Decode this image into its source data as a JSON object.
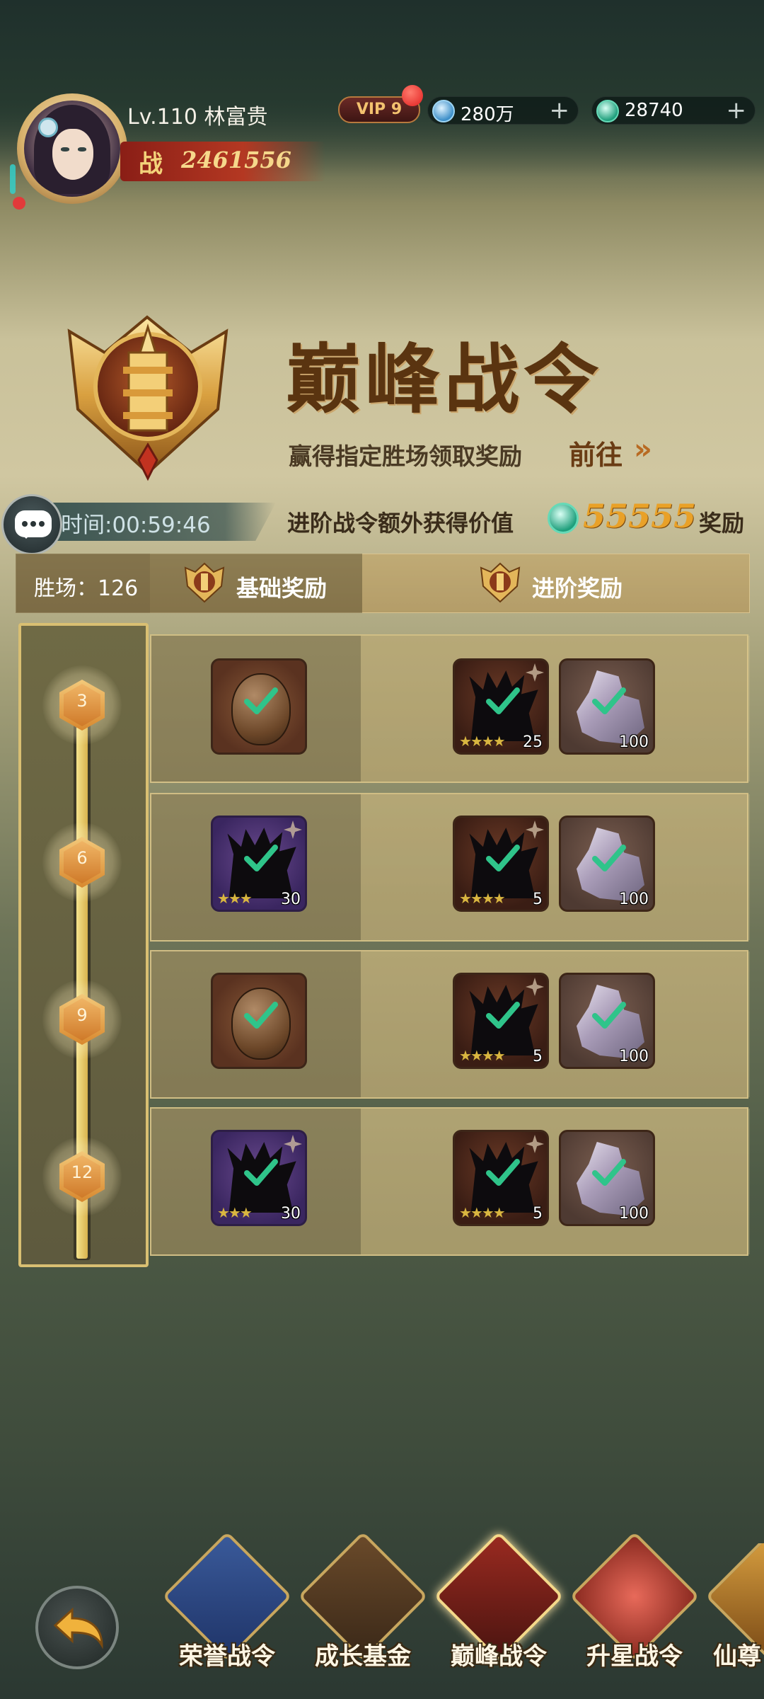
{
  "player": {
    "level_name": "Lv.110 林富贵",
    "power_glyph": "战",
    "power": "2461556",
    "vip": "VIP 9"
  },
  "resources": [
    {
      "name": "diamond",
      "value": "280万",
      "icon": "diamond-icon"
    },
    {
      "name": "jade",
      "value": "28740",
      "icon": "jade-coin-icon"
    }
  ],
  "banner": {
    "title": "巅峰战令",
    "subtitle": "赢得指定胜场领取奖励",
    "goto_label": "前往",
    "goto_arrow": "»",
    "timer": "时间:00:59:46",
    "advanced_text": "进阶战令额外获得价值",
    "advanced_value": "55555",
    "advanced_suffix": "奖励"
  },
  "columns": {
    "wins": "胜场：126",
    "base": "基础奖励",
    "advanced": "进阶奖励"
  },
  "progress": {
    "fill_fraction": 1.0
  },
  "rows": [
    {
      "milestone": "3",
      "base": [
        {
          "type": "egg",
          "count": ""
        }
      ],
      "advanced": [
        {
          "type": "hero-shard",
          "stars": "★★★★",
          "count": "25"
        },
        {
          "type": "crystal",
          "count": "100"
        }
      ]
    },
    {
      "milestone": "6",
      "base": [
        {
          "type": "hero-shard-purple",
          "stars": "★★★",
          "count": "30"
        }
      ],
      "advanced": [
        {
          "type": "hero-shard",
          "stars": "★★★★",
          "count": "5"
        },
        {
          "type": "crystal",
          "count": "100"
        }
      ]
    },
    {
      "milestone": "9",
      "base": [
        {
          "type": "egg",
          "count": ""
        }
      ],
      "advanced": [
        {
          "type": "hero-shard",
          "stars": "★★★★",
          "count": "5"
        },
        {
          "type": "crystal",
          "count": "100"
        }
      ]
    },
    {
      "milestone": "12",
      "base": [
        {
          "type": "hero-shard-purple",
          "stars": "★★★",
          "count": "30"
        }
      ],
      "advanced": [
        {
          "type": "hero-shard",
          "stars": "★★★★",
          "count": "5"
        },
        {
          "type": "crystal",
          "count": "100"
        }
      ]
    }
  ],
  "nav": [
    {
      "label": "荣誉战令",
      "active": false
    },
    {
      "label": "成长基金",
      "active": false
    },
    {
      "label": "巅峰战令",
      "active": true
    },
    {
      "label": "升星战令",
      "active": false
    },
    {
      "label": "仙尊",
      "active": false
    }
  ],
  "colors": {
    "accent_gold": "#d9bf72",
    "advanced_value": "#e9a128",
    "check_green": "#2fc48a",
    "vip_dot": "#e11f1f"
  }
}
